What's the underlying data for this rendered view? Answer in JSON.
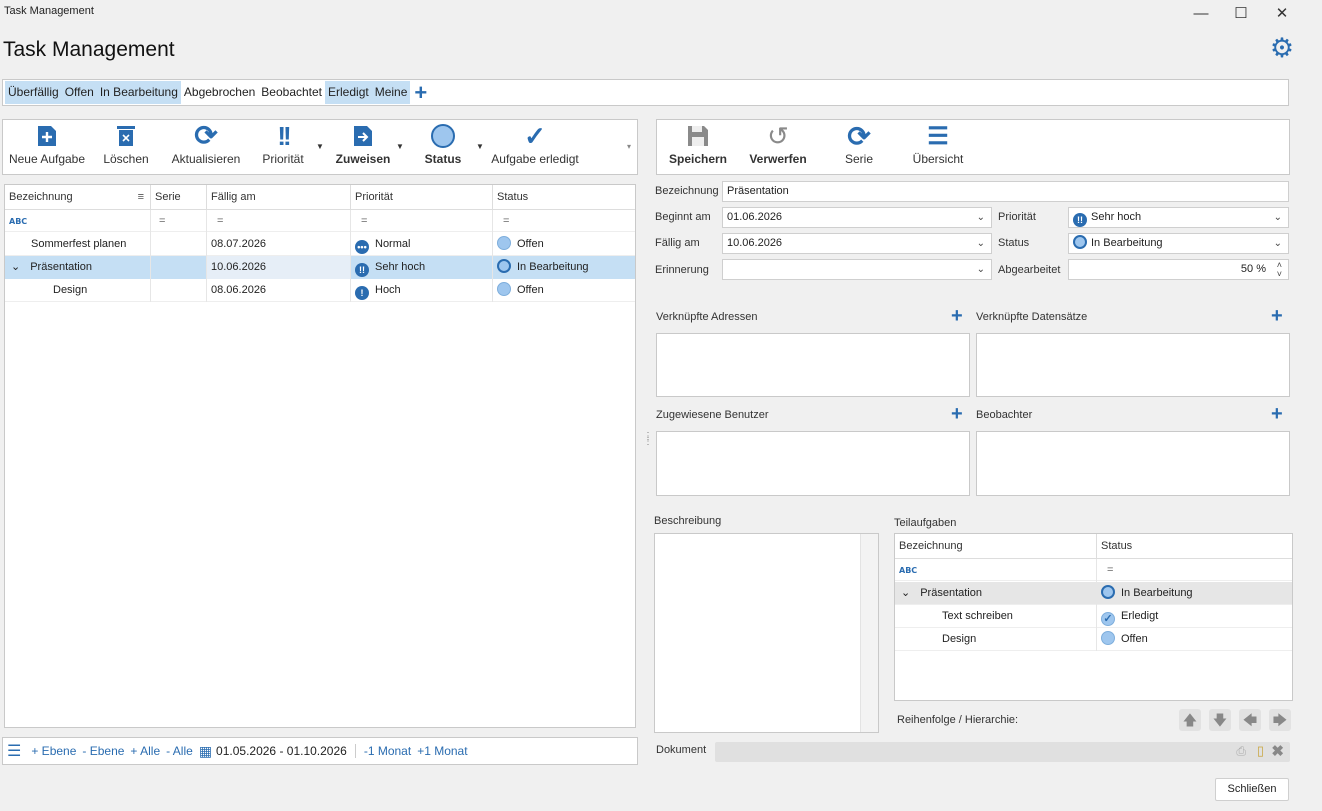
{
  "window": {
    "title": "Task Management",
    "minimize": "—",
    "maximize": "☐",
    "close": "✕"
  },
  "app_title": "Task Management",
  "filter_tabs": [
    {
      "label": "Überfällig",
      "selected": true
    },
    {
      "label": "Offen",
      "selected": true
    },
    {
      "label": "In Bearbeitung",
      "selected": true
    },
    {
      "label": "Abgebrochen",
      "selected": false
    },
    {
      "label": "Beobachtet",
      "selected": false
    },
    {
      "label": "Erledigt",
      "selected": true
    },
    {
      "label": "Meine",
      "selected": true
    }
  ],
  "toolbar_left": [
    {
      "label": "Neue Aufgabe",
      "icon": "new-task-icon"
    },
    {
      "label": "Löschen",
      "icon": "delete-icon"
    },
    {
      "label": "Aktualisieren",
      "icon": "refresh-icon"
    },
    {
      "label": "Priorität",
      "icon": "priority-icon"
    },
    {
      "label": "Zuweisen",
      "icon": "assign-icon"
    },
    {
      "label": "Status",
      "icon": "status-icon"
    },
    {
      "label": "Aufgabe erledigt",
      "icon": "check-icon"
    }
  ],
  "toolbar_right": [
    {
      "label": "Speichern",
      "icon": "save-icon"
    },
    {
      "label": "Verwerfen",
      "icon": "undo-icon"
    },
    {
      "label": "Serie",
      "icon": "series-icon"
    },
    {
      "label": "Übersicht",
      "icon": "list-icon"
    }
  ],
  "task_grid": {
    "columns": [
      "Bezeichnung",
      "Serie",
      "Fällig am",
      "Priorität",
      "Status"
    ],
    "filter_abc": "ABC",
    "filter_eq": "=",
    "rows": [
      {
        "name": "Sommerfest planen",
        "serie": "",
        "due": "08.07.2026",
        "priority": "Normal",
        "status": "Offen"
      },
      {
        "name": "Präsentation",
        "serie": "",
        "due": "10.06.2026",
        "priority": "Sehr hoch",
        "status": "In Bearbeitung"
      },
      {
        "name": "Design",
        "serie": "",
        "due": "08.06.2026",
        "priority": "Hoch",
        "status": "Offen"
      }
    ]
  },
  "bottom_bar": {
    "add_level": "+ Ebene",
    "remove_level": "- Ebene",
    "add_all": "+ Alle",
    "remove_all": "- Alle",
    "date_range": "01.05.2026 - 01.10.2026",
    "minus_month": "-1 Monat",
    "plus_month": "+1 Monat"
  },
  "detail": {
    "bezeichnung_label": "Bezeichnung",
    "bezeichnung_value": "Präsentation",
    "beginnt_label": "Beginnt am",
    "beginnt_value": "01.06.2026",
    "faellig_label": "Fällig am",
    "faellig_value": "10.06.2026",
    "erinnerung_label": "Erinnerung",
    "erinnerung_value": "",
    "prioritaet_label": "Priorität",
    "prioritaet_value": "Sehr hoch",
    "status_label": "Status",
    "status_value": "In Bearbeitung",
    "abgearbeitet_label": "Abgearbeitet",
    "abgearbeitet_value": "50 %",
    "adressen_label": "Verknüpfte Adressen",
    "datensaetze_label": "Verknüpfte Datensätze",
    "benutzer_label": "Zugewiesene Benutzer",
    "beobachter_label": "Beobachter",
    "beschreibung_label": "Beschreibung",
    "teilaufgaben_label": "Teilaufgaben",
    "reihenfolge_label": "Reihenfolge / Hierarchie:",
    "dokument_label": "Dokument",
    "close_label": "Schließen"
  },
  "subtasks": {
    "columns": [
      "Bezeichnung",
      "Status"
    ],
    "rows": [
      {
        "name": "Präsentation",
        "status": "In Bearbeitung"
      },
      {
        "name": "Text schreiben",
        "status": "Erledigt"
      },
      {
        "name": "Design",
        "status": "Offen"
      }
    ]
  },
  "colors": {
    "accent": "#2a6cb0",
    "selection": "#c5dff4"
  }
}
